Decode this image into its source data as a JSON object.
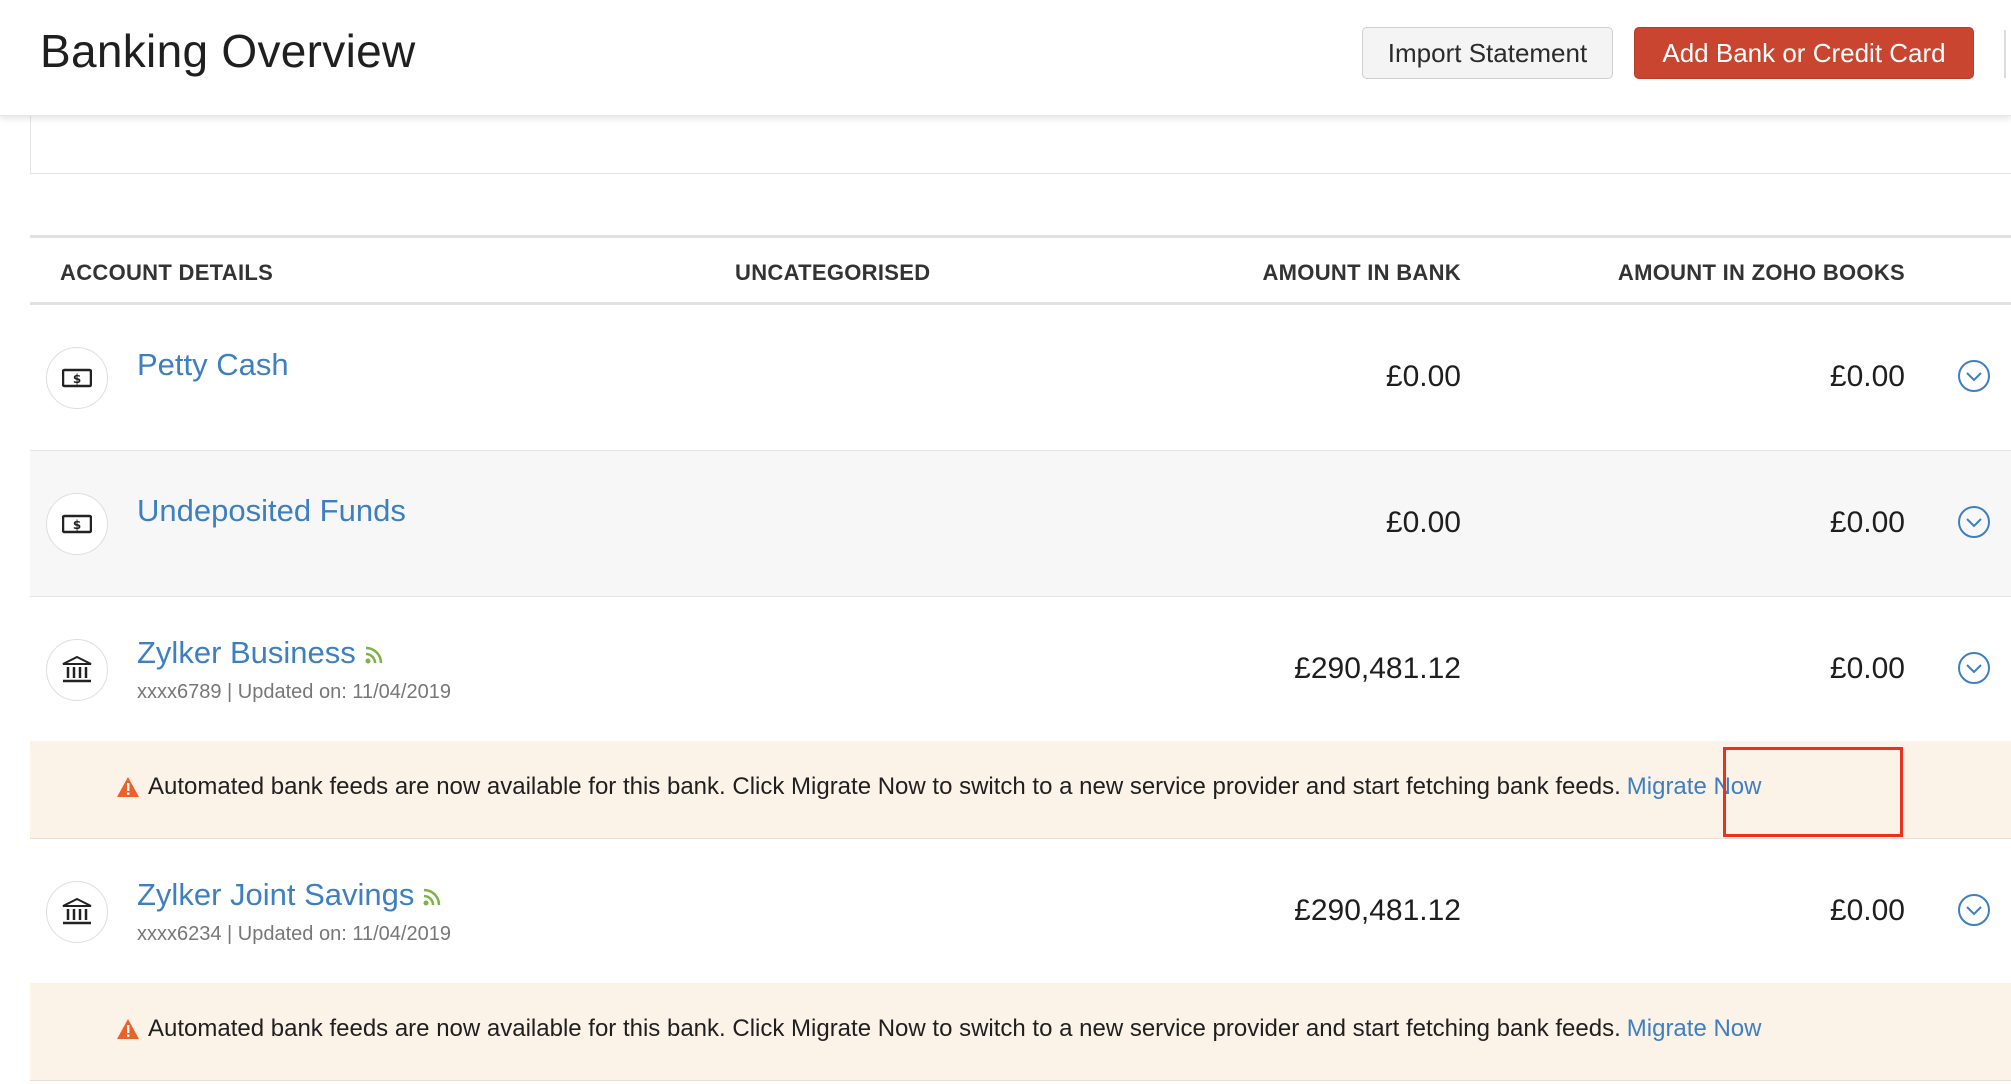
{
  "header": {
    "title": "Banking Overview",
    "import_label": "Import Statement",
    "add_label": "Add Bank or Credit Card",
    "add_color": "#c9452f"
  },
  "table": {
    "columns": [
      "ACCOUNT DETAILS",
      "UNCATEGORISED",
      "AMOUNT IN BANK",
      "AMOUNT IN ZOHO BOOKS"
    ],
    "rows": [
      {
        "name": "Petty Cash",
        "icon": "cash-icon",
        "sub": "",
        "amount_bank": "£0.00",
        "amount_books": "£0.00"
      },
      {
        "name": "Undeposited Funds",
        "icon": "cash-icon",
        "sub": "",
        "amount_bank": "£0.00",
        "amount_books": "£0.00"
      },
      {
        "name": "Zylker Business",
        "icon": "bank-icon",
        "feed": true,
        "sub": "xxxx6789 | Updated on: 11/04/2019",
        "amount_bank": "£290,481.12",
        "amount_books": "£0.00"
      },
      {
        "name": "Zylker Joint Savings",
        "icon": "bank-icon",
        "feed": true,
        "sub": "xxxx6234 | Updated on: 11/04/2019",
        "amount_bank": "£290,481.12",
        "amount_books": "£0.00"
      }
    ]
  },
  "notice": {
    "text": "Automated bank feeds are now available for this bank. Click Migrate Now to switch to a new service provider and start fetching bank feeds.",
    "link": "Migrate Now"
  },
  "colors": {
    "link": "#3d7fc1",
    "warning": "#e8632a",
    "feed": "#7cb342",
    "highlight": "#e8321f"
  }
}
